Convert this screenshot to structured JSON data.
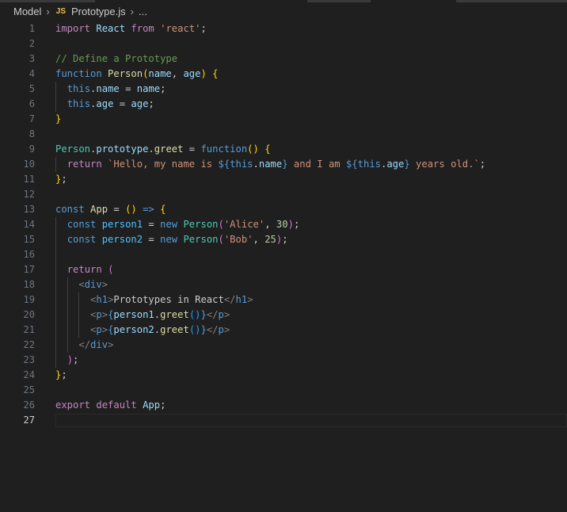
{
  "breadcrumb": {
    "folder": "Model",
    "file_icon": "JS",
    "file": "Prototype.js",
    "more": "..."
  },
  "editor": {
    "language": "javascript",
    "active_line": 27,
    "lines": [
      [
        [
          "kw",
          "import"
        ],
        [
          "pl",
          " "
        ],
        [
          "vr",
          "React"
        ],
        [
          "pl",
          " "
        ],
        [
          "kw",
          "from"
        ],
        [
          "pl",
          " "
        ],
        [
          "str",
          "'react'"
        ],
        [
          "pl",
          ";"
        ]
      ],
      [],
      [
        [
          "cm",
          "// Define a Prototype"
        ]
      ],
      [
        [
          "st",
          "function"
        ],
        [
          "pl",
          " "
        ],
        [
          "fn",
          "Person"
        ],
        [
          "b1",
          "("
        ],
        [
          "vr",
          "name"
        ],
        [
          "pl",
          ", "
        ],
        [
          "vr",
          "age"
        ],
        [
          "b1",
          ")"
        ],
        [
          "pl",
          " "
        ],
        [
          "b1",
          "{"
        ]
      ],
      [
        [
          "pl",
          "  "
        ],
        [
          "st",
          "this"
        ],
        [
          "pl",
          "."
        ],
        [
          "vr",
          "name"
        ],
        [
          "pl",
          " = "
        ],
        [
          "vr",
          "name"
        ],
        [
          "pl",
          ";"
        ]
      ],
      [
        [
          "pl",
          "  "
        ],
        [
          "st",
          "this"
        ],
        [
          "pl",
          "."
        ],
        [
          "vr",
          "age"
        ],
        [
          "pl",
          " = "
        ],
        [
          "vr",
          "age"
        ],
        [
          "pl",
          ";"
        ]
      ],
      [
        [
          "b1",
          "}"
        ]
      ],
      [],
      [
        [
          "ty",
          "Person"
        ],
        [
          "pl",
          "."
        ],
        [
          "vr",
          "prototype"
        ],
        [
          "pl",
          "."
        ],
        [
          "fn",
          "greet"
        ],
        [
          "pl",
          " = "
        ],
        [
          "st",
          "function"
        ],
        [
          "b1",
          "()"
        ],
        [
          "pl",
          " "
        ],
        [
          "b1",
          "{"
        ]
      ],
      [
        [
          "pl",
          "  "
        ],
        [
          "kw",
          "return"
        ],
        [
          "pl",
          " "
        ],
        [
          "str",
          "`Hello, my name is "
        ],
        [
          "st",
          "${"
        ],
        [
          "st",
          "this"
        ],
        [
          "pl",
          "."
        ],
        [
          "vr",
          "name"
        ],
        [
          "st",
          "}"
        ],
        [
          "str",
          " and I am "
        ],
        [
          "st",
          "${"
        ],
        [
          "st",
          "this"
        ],
        [
          "pl",
          "."
        ],
        [
          "vr",
          "age"
        ],
        [
          "st",
          "}"
        ],
        [
          "str",
          " years old.`"
        ],
        [
          "pl",
          ";"
        ]
      ],
      [
        [
          "b1",
          "}"
        ],
        [
          "pl",
          ";"
        ]
      ],
      [],
      [
        [
          "st",
          "const"
        ],
        [
          "pl",
          " "
        ],
        [
          "fn",
          "App"
        ],
        [
          "pl",
          " = "
        ],
        [
          "b1",
          "()"
        ],
        [
          "pl",
          " "
        ],
        [
          "st",
          "=>"
        ],
        [
          "pl",
          " "
        ],
        [
          "b1",
          "{"
        ]
      ],
      [
        [
          "pl",
          "  "
        ],
        [
          "st",
          "const"
        ],
        [
          "pl",
          " "
        ],
        [
          "cn",
          "person1"
        ],
        [
          "pl",
          " = "
        ],
        [
          "st",
          "new"
        ],
        [
          "pl",
          " "
        ],
        [
          "ty",
          "Person"
        ],
        [
          "b2",
          "("
        ],
        [
          "str",
          "'Alice'"
        ],
        [
          "pl",
          ", "
        ],
        [
          "num",
          "30"
        ],
        [
          "b2",
          ")"
        ],
        [
          "pl",
          ";"
        ]
      ],
      [
        [
          "pl",
          "  "
        ],
        [
          "st",
          "const"
        ],
        [
          "pl",
          " "
        ],
        [
          "cn",
          "person2"
        ],
        [
          "pl",
          " = "
        ],
        [
          "st",
          "new"
        ],
        [
          "pl",
          " "
        ],
        [
          "ty",
          "Person"
        ],
        [
          "b2",
          "("
        ],
        [
          "str",
          "'Bob'"
        ],
        [
          "pl",
          ", "
        ],
        [
          "num",
          "25"
        ],
        [
          "b2",
          ")"
        ],
        [
          "pl",
          ";"
        ]
      ],
      [],
      [
        [
          "pl",
          "  "
        ],
        [
          "kw",
          "return"
        ],
        [
          "pl",
          " "
        ],
        [
          "b2",
          "("
        ]
      ],
      [
        [
          "pl",
          "    "
        ],
        [
          "ang",
          "<"
        ],
        [
          "tg",
          "div"
        ],
        [
          "ang",
          ">"
        ]
      ],
      [
        [
          "pl",
          "      "
        ],
        [
          "ang",
          "<"
        ],
        [
          "tg",
          "h1"
        ],
        [
          "ang",
          ">"
        ],
        [
          "pl",
          "Prototypes in React"
        ],
        [
          "ang",
          "</"
        ],
        [
          "tg",
          "h1"
        ],
        [
          "ang",
          ">"
        ]
      ],
      [
        [
          "pl",
          "      "
        ],
        [
          "ang",
          "<"
        ],
        [
          "tg",
          "p"
        ],
        [
          "ang",
          ">"
        ],
        [
          "st",
          "{"
        ],
        [
          "vr",
          "person1"
        ],
        [
          "pl",
          "."
        ],
        [
          "fn",
          "greet"
        ],
        [
          "b3",
          "()"
        ],
        [
          "st",
          "}"
        ],
        [
          "ang",
          "</"
        ],
        [
          "tg",
          "p"
        ],
        [
          "ang",
          ">"
        ]
      ],
      [
        [
          "pl",
          "      "
        ],
        [
          "ang",
          "<"
        ],
        [
          "tg",
          "p"
        ],
        [
          "ang",
          ">"
        ],
        [
          "st",
          "{"
        ],
        [
          "vr",
          "person2"
        ],
        [
          "pl",
          "."
        ],
        [
          "fn",
          "greet"
        ],
        [
          "b3",
          "()"
        ],
        [
          "st",
          "}"
        ],
        [
          "ang",
          "</"
        ],
        [
          "tg",
          "p"
        ],
        [
          "ang",
          ">"
        ]
      ],
      [
        [
          "pl",
          "    "
        ],
        [
          "ang",
          "</"
        ],
        [
          "tg",
          "div"
        ],
        [
          "ang",
          ">"
        ]
      ],
      [
        [
          "pl",
          "  "
        ],
        [
          "b2",
          ")"
        ],
        [
          "pl",
          ";"
        ]
      ],
      [
        [
          "b1",
          "}"
        ],
        [
          "pl",
          ";"
        ]
      ],
      [],
      [
        [
          "kw",
          "export"
        ],
        [
          "pl",
          " "
        ],
        [
          "kw",
          "default"
        ],
        [
          "pl",
          " "
        ],
        [
          "vr",
          "App"
        ],
        [
          "pl",
          ";"
        ]
      ],
      []
    ]
  }
}
